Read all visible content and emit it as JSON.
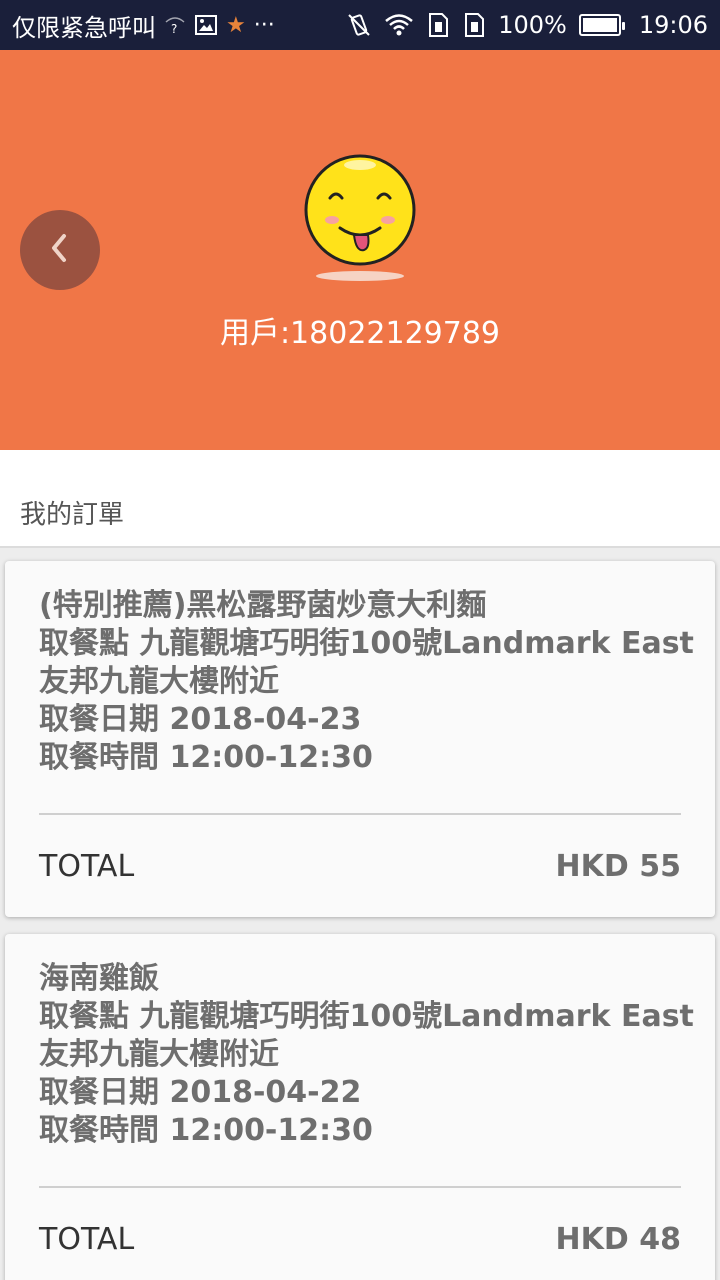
{
  "status_bar": {
    "carrier": "仅限紧急呼叫",
    "battery_percent": "100%",
    "time": "19:06"
  },
  "header": {
    "user_label": "用戶:18022129789",
    "back_icon": "chevron-left-icon",
    "avatar_icon": "smiley-face-icon",
    "bg_color": "#f07647"
  },
  "section": {
    "title": "我的訂單"
  },
  "orders": [
    {
      "name": "(特別推薦)黑松露野菌炒意大利麵",
      "pickup_line1": "取餐點 九龍觀塘巧明街100號Landmark East",
      "pickup_line2": "友邦九龍大樓附近",
      "date": "取餐日期 2018-04-23",
      "time": "取餐時間 12:00-12:30",
      "total_label": "TOTAL",
      "total_value": "HKD 55"
    },
    {
      "name": "海南雞飯",
      "pickup_line1": "取餐點 九龍觀塘巧明街100號Landmark East",
      "pickup_line2": "友邦九龍大樓附近",
      "date": "取餐日期 2018-04-22",
      "time": "取餐時間 12:00-12:30",
      "total_label": "TOTAL",
      "total_value": "HKD 48"
    }
  ]
}
